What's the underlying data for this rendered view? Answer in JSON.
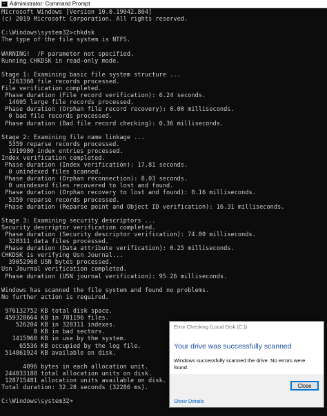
{
  "window": {
    "title": "Administrator: Command Prompt",
    "icon": "cmd-icon"
  },
  "console": {
    "lines": [
      "Microsoft Windows [Version 10.0.19042.804]",
      "(c) 2019 Microsoft Corporation. All rights reserved.",
      "",
      "C:\\Windows\\system32>chkdsk",
      "The type of the file system is NTFS.",
      "",
      "WARNING!  /F parameter not specified.",
      "Running CHKDSK in read-only mode.",
      "",
      "Stage 1: Examining basic file system structure ...",
      "  1263360 file records processed.",
      "File verification completed.",
      " Phase duration (File record verification): 6.24 seconds.",
      "  14605 large file records processed.",
      " Phase duration (Orphan file record recovery): 0.00 milliseconds.",
      "  0 bad file records processed.",
      " Phase duration (Bad file record checking): 0.36 milliseconds.",
      "",
      "Stage 2: Examining file name linkage ...",
      "  5359 reparse records processed.",
      "  1919980 index entries processed.",
      "Index verification completed.",
      " Phase duration (Index verification): 17.81 seconds.",
      "  0 unindexed files scanned.",
      " Phase duration (Orphan reconnection): 8.03 seconds.",
      "  0 unindexed files recovered to lost and found.",
      " Phase duration (Orphan recovery to lost and found): 0.16 milliseconds.",
      "  5359 reparse records processed.",
      " Phase duration (Reparse point and Object ID verification): 16.31 milliseconds.",
      "",
      "Stage 3: Examining security descriptors ...",
      "Security descriptor verification completed.",
      " Phase duration (Security descriptor verification): 74.00 milliseconds.",
      "  328311 data files processed.",
      " Phase duration (Data attribute verification): 0.25 milliseconds.",
      "CHKDSK is verifying Usn Journal...",
      "  39052968 USN bytes processed.",
      "Usn Journal verification completed.",
      " Phase duration (USN journal verification): 95.26 milliseconds.",
      "",
      "Windows has scanned the file system and found no problems.",
      "No further action is required.",
      "",
      " 976132752 KB total disk space.",
      " 459328664 KB in 781196 files.",
      "    526204 KB in 328311 indexes.",
      "         0 KB in bad sectors.",
      "   1415960 KB in use by the system.",
      "     65536 KB occupied by the log file.",
      " 514861924 KB available on disk.",
      "",
      "      4096 bytes in each allocation unit.",
      " 244033188 total allocation units on disk.",
      " 128715481 allocation units available on disk.",
      "Total duration: 32.28 seconds (32286 ms).",
      "",
      "C:\\Windows\\system32>"
    ]
  },
  "dialog": {
    "title": "Error Checking (Local Disk (C:))",
    "heading": "Your drive was successfully scanned",
    "message": "Windows successfully scanned the drive. No errors were found.",
    "close_label": "Close",
    "details_label": "Show Details"
  }
}
